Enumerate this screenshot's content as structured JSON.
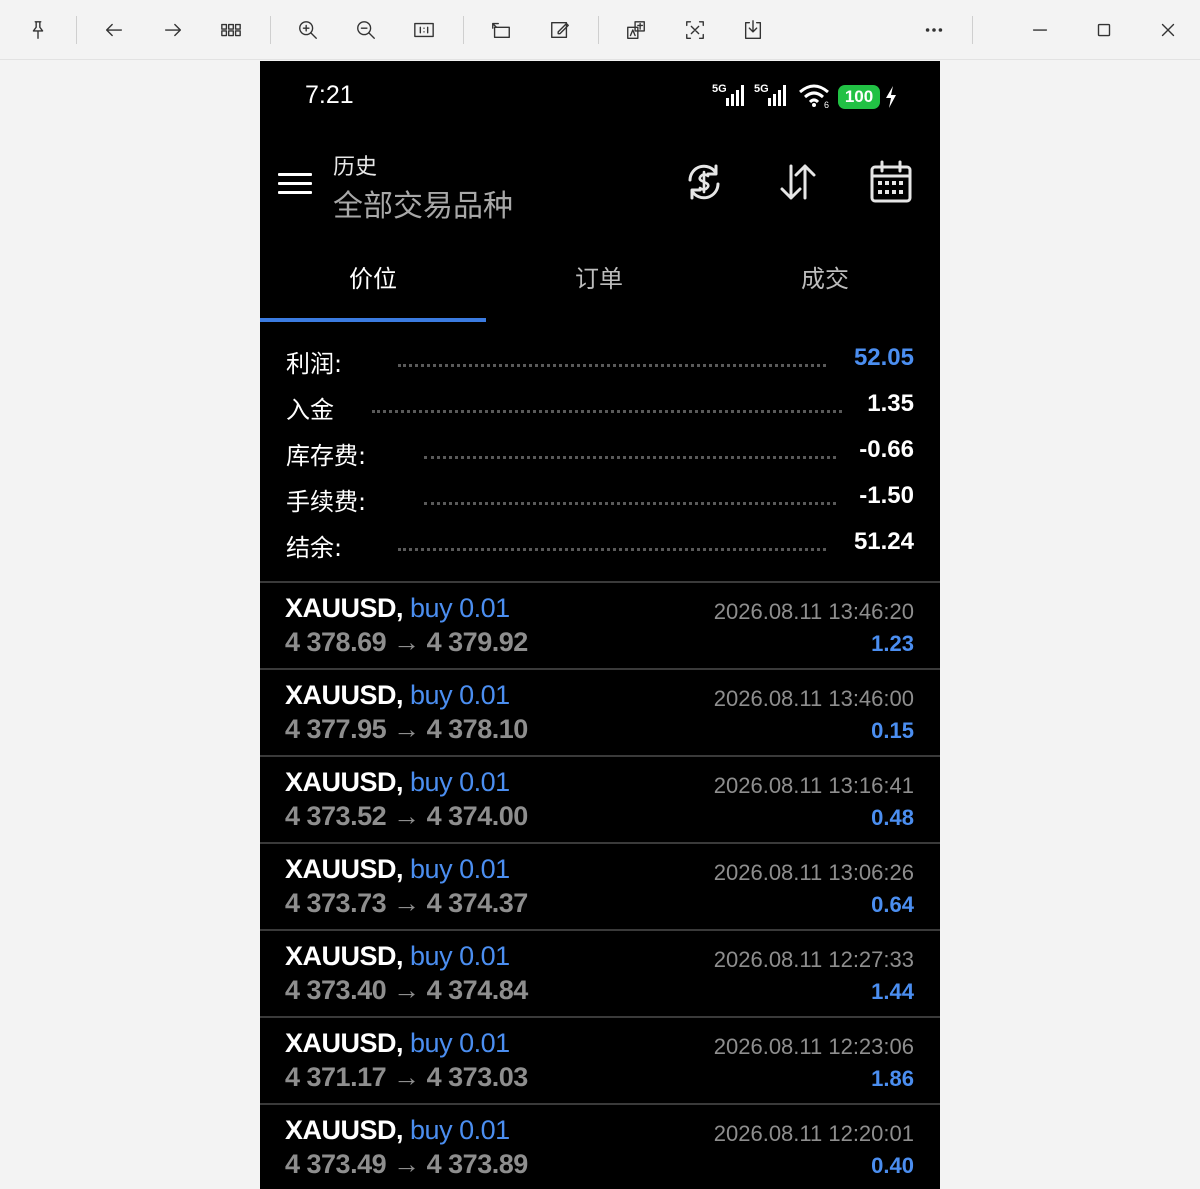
{
  "viewer": {
    "icons": [
      "pin-icon",
      "back-arrow-icon",
      "forward-arrow-icon",
      "grid-icon",
      "zoom-in-icon",
      "zoom-out-icon",
      "actual-size-icon",
      "rotate-icon",
      "edit-icon",
      "translate-icon",
      "text-recognize-icon",
      "save-icon",
      "more-icon",
      "minimize-icon",
      "maximize-icon",
      "close-icon"
    ]
  },
  "status_bar": {
    "time": "7:21",
    "network_1": "5G",
    "network_2": "5G",
    "battery": "100"
  },
  "header": {
    "subtitle": "历史",
    "title": "全部交易品种"
  },
  "tabs": [
    {
      "label": "价位",
      "active": true
    },
    {
      "label": "订单",
      "active": false
    },
    {
      "label": "成交",
      "active": false
    }
  ],
  "summary": [
    {
      "label": "利润:",
      "value": "52.05",
      "accent": true
    },
    {
      "label": "入金",
      "value": "1.35",
      "accent": false
    },
    {
      "label": "库存费:",
      "value": "-0.66",
      "accent": false
    },
    {
      "label": "手续费:",
      "value": "-1.50",
      "accent": false
    },
    {
      "label": "结余:",
      "value": "51.24",
      "accent": false
    }
  ],
  "deals": [
    {
      "symbol": "XAUUSD,",
      "side": "buy 0.01",
      "open": "4 378.69",
      "arrow": "→",
      "close": "4 379.92",
      "time": "2026.08.11 13:46:20",
      "profit": "1.23"
    },
    {
      "symbol": "XAUUSD,",
      "side": "buy 0.01",
      "open": "4 377.95",
      "arrow": "→",
      "close": "4 378.10",
      "time": "2026.08.11 13:46:00",
      "profit": "0.15"
    },
    {
      "symbol": "XAUUSD,",
      "side": "buy 0.01",
      "open": "4 373.52",
      "arrow": "→",
      "close": "4 374.00",
      "time": "2026.08.11 13:16:41",
      "profit": "0.48"
    },
    {
      "symbol": "XAUUSD,",
      "side": "buy 0.01",
      "open": "4 373.73",
      "arrow": "→",
      "close": "4 374.37",
      "time": "2026.08.11 13:06:26",
      "profit": "0.64"
    },
    {
      "symbol": "XAUUSD,",
      "side": "buy 0.01",
      "open": "4 373.40",
      "arrow": "→",
      "close": "4 374.84",
      "time": "2026.08.11 12:27:33",
      "profit": "1.44"
    },
    {
      "symbol": "XAUUSD,",
      "side": "buy 0.01",
      "open": "4 371.17",
      "arrow": "→",
      "close": "4 373.03",
      "time": "2026.08.11 12:23:06",
      "profit": "1.86"
    },
    {
      "symbol": "XAUUSD,",
      "side": "buy 0.01",
      "open": "4 373.49",
      "arrow": "→",
      "close": "4 373.89",
      "time": "2026.08.11 12:20:01",
      "profit": "0.40"
    }
  ],
  "colors": {
    "accent": "#4b8ef0",
    "background": "#000000",
    "battery": "#21c144"
  }
}
